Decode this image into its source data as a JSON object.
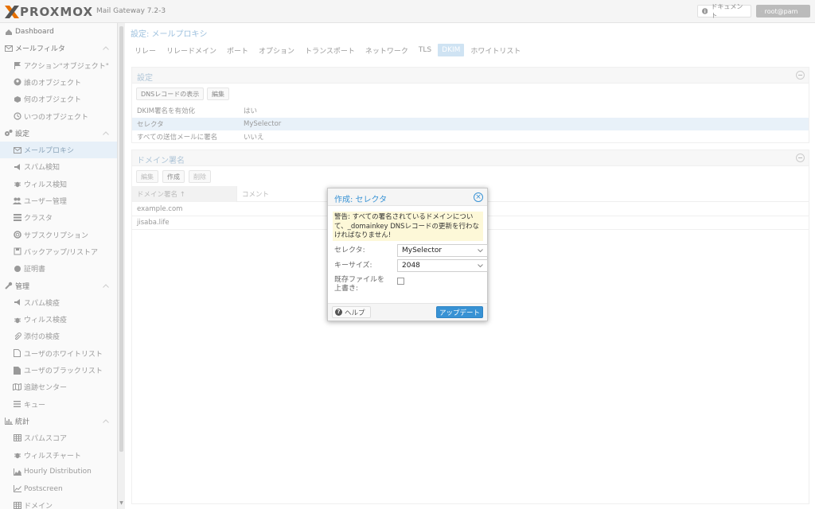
{
  "header": {
    "logo_text": "PROXMOX",
    "version": "Mail Gateway 7.2-3",
    "docs_label": "ドキュメント",
    "user_label": "root@pam"
  },
  "sidebar": {
    "items": [
      {
        "label": "Dashboard",
        "icon": "dashboard-icon",
        "level": 0
      },
      {
        "label": "メールフィルタ",
        "icon": "envelope-icon",
        "level": 0,
        "expandable": true
      },
      {
        "label": "アクション\"オブジェクト\"",
        "icon": "flag-icon",
        "level": 1
      },
      {
        "label": "誰のオブジェクト",
        "icon": "user-circle-icon",
        "level": 1
      },
      {
        "label": "何のオブジェクト",
        "icon": "cube-icon",
        "level": 1
      },
      {
        "label": "いつのオブジェクト",
        "icon": "clock-icon",
        "level": 1
      },
      {
        "label": "設定",
        "icon": "cogs-icon",
        "level": 0,
        "expandable": true
      },
      {
        "label": "メールプロキシ",
        "icon": "envelope-icon",
        "level": 1,
        "selected": true
      },
      {
        "label": "スパム検知",
        "icon": "bullhorn-icon",
        "level": 1
      },
      {
        "label": "ウィルス検知",
        "icon": "bug-icon",
        "level": 1
      },
      {
        "label": "ユーザー管理",
        "icon": "users-icon",
        "level": 1
      },
      {
        "label": "クラスタ",
        "icon": "server-icon",
        "level": 1
      },
      {
        "label": "サブスクリプション",
        "icon": "support-icon",
        "level": 1
      },
      {
        "label": "バックアップ/リストア",
        "icon": "floppy-icon",
        "level": 1
      },
      {
        "label": "証明書",
        "icon": "certificate-icon",
        "level": 1
      },
      {
        "label": "管理",
        "icon": "wrench-icon",
        "level": 0,
        "expandable": true
      },
      {
        "label": "スパム検疫",
        "icon": "bullhorn-icon",
        "level": 1
      },
      {
        "label": "ウィルス検疫",
        "icon": "bug-icon",
        "level": 1
      },
      {
        "label": "添付の検疫",
        "icon": "paperclip-icon",
        "level": 1
      },
      {
        "label": "ユーザのホワイトリスト",
        "icon": "file-icon",
        "level": 1
      },
      {
        "label": "ユーザのブラックリスト",
        "icon": "file-solid-icon",
        "level": 1
      },
      {
        "label": "追跡センター",
        "icon": "map-icon",
        "level": 1
      },
      {
        "label": "キュー",
        "icon": "bars-icon",
        "level": 1
      },
      {
        "label": "統計",
        "icon": "bar-chart-icon",
        "level": 0,
        "expandable": true
      },
      {
        "label": "スパムスコア",
        "icon": "table-icon",
        "level": 1
      },
      {
        "label": "ウィルスチャート",
        "icon": "bug-icon",
        "level": 1
      },
      {
        "label": "Hourly Distribution",
        "icon": "area-chart-icon",
        "level": 1
      },
      {
        "label": "Postscreen",
        "icon": "line-chart-icon",
        "level": 1
      },
      {
        "label": "ドメイン",
        "icon": "table-icon",
        "level": 1
      }
    ]
  },
  "main": {
    "title": "設定: メールプロキシ",
    "tabs": [
      "リレー",
      "リレードメイン",
      "ポート",
      "オプション",
      "トランスポート",
      "ネットワーク",
      "TLS",
      "DKIM",
      "ホワイトリスト"
    ],
    "active_tab": "DKIM",
    "settings_panel": {
      "title": "設定",
      "buttons": [
        "DNSレコードの表示",
        "編集"
      ],
      "rows": [
        {
          "key": "DKIM署名を有効化",
          "value": "はい"
        },
        {
          "key": "セレクタ",
          "value": "MySelector",
          "selected": true
        },
        {
          "key": "すべての送信メールに署名",
          "value": "いいえ"
        }
      ]
    },
    "domain_panel": {
      "title": "ドメイン署名",
      "buttons": [
        "編集",
        "作成",
        "削除"
      ],
      "columns": [
        "ドメイン署名 ↑",
        "コメント"
      ],
      "rows": [
        "example.com",
        "jisaba.life"
      ]
    }
  },
  "dialog": {
    "title": "作成: セレクタ",
    "warning": "警告: すべての署名されているドメインについて、_domainkey DNSレコードの更新を行わなければなりません!",
    "fields": {
      "selector_label": "セレクタ:",
      "selector_value": "MySelector",
      "keysize_label": "キーサイズ:",
      "keysize_value": "2048",
      "overwrite_label": "既存ファイルを上書き:",
      "overwrite_checked": false
    },
    "help_label": "ヘルプ",
    "update_label": "アップデート"
  }
}
